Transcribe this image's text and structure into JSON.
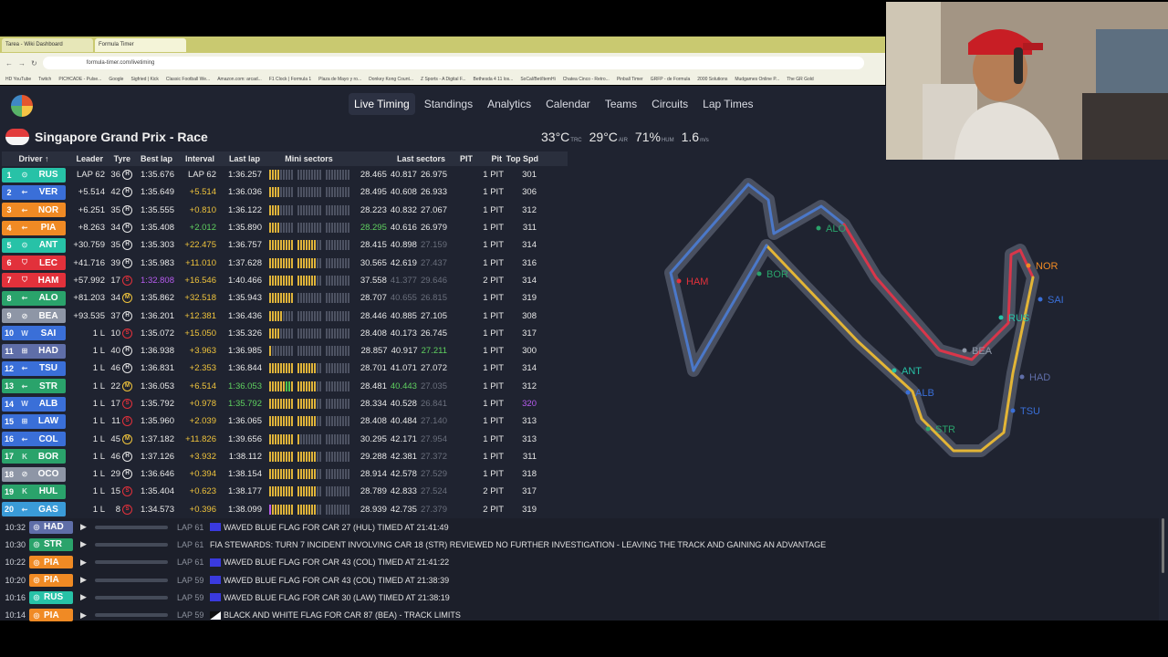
{
  "browser": {
    "tabs": [
      "Tarea - Wiki Dashboard",
      "Formula Timer"
    ],
    "url": "formula-timer.com/livetiming",
    "bookmarks": [
      "HD YouTube",
      "Twitch",
      "PICHCADE - Pulse...",
      "Google",
      "Sigfried | Kick",
      "Classic Football We...",
      "Amazon.com: arcad...",
      "F1 Clock | Formula 1",
      "Plaza de Mayo y ro...",
      "Donkey Kong Count...",
      "Z Sports - A Digital F...",
      "Bethesda 4 11 los...",
      "SoCal/Bet/ItemHi",
      "Chatea Cinco - Retro...",
      "Pinball Timer",
      "GRFP - de Formula",
      "2000 Solutions",
      "Mudgames Online P...",
      "The GR Gold"
    ]
  },
  "nav": {
    "items": [
      "Live Timing",
      "Standings",
      "Analytics",
      "Calendar",
      "Teams",
      "Circuits",
      "Lap Times"
    ],
    "active": "Live Timing"
  },
  "race": {
    "title": "Singapore Grand Prix - Race",
    "weather": {
      "track_temp": "33°C",
      "track_label": "TRC",
      "air_temp": "29°C",
      "air_label": "AIR",
      "humidity": "71%",
      "humidity_label": "HUM",
      "wind": "1.6",
      "wind_label": "m/s"
    }
  },
  "table": {
    "headers": [
      "Driver ↑",
      "Leader",
      "Tyre",
      "Best lap",
      "Interval",
      "Last lap",
      "Mini sectors",
      "Last sectors",
      "PIT",
      "Pit",
      "Top Spd"
    ],
    "rows": [
      {
        "pos": "1",
        "code": "RUS",
        "color": "#27c2a7",
        "icon": "⊙",
        "leader": "LAP 62",
        "laps": "36",
        "tyre": "H",
        "best": "1:35.676",
        "bestc": "white",
        "int": "LAP 62",
        "intc": "white",
        "last": "1:36.257",
        "lastc": "white",
        "mini": "yyyydddddddddddd",
        "s1": "28.465",
        "s1c": "white",
        "s2": "40.817",
        "s2c": "white",
        "s3": "26.975",
        "s3c": "white",
        "pit": "",
        "pits": "1 PIT",
        "spd": "301",
        "spdc": "white"
      },
      {
        "pos": "2",
        "code": "VER",
        "color": "#3a6fd8",
        "icon": "⇜",
        "leader": "+5.514",
        "laps": "42",
        "tyre": "H",
        "best": "1:35.649",
        "bestc": "white",
        "int": "+5.514",
        "intc": "yellow",
        "last": "1:36.036",
        "lastc": "white",
        "mini": "yyyydddddddddddd",
        "s1": "28.495",
        "s1c": "white",
        "s2": "40.608",
        "s2c": "white",
        "s3": "26.933",
        "s3c": "white",
        "pit": "",
        "pits": "1 PIT",
        "spd": "306",
        "spdc": "white"
      },
      {
        "pos": "3",
        "code": "NOR",
        "color": "#f08a24",
        "icon": "⇜",
        "leader": "+6.251",
        "laps": "35",
        "tyre": "H",
        "best": "1:35.555",
        "bestc": "white",
        "int": "+0.810",
        "intc": "yellow",
        "last": "1:36.122",
        "lastc": "white",
        "mini": "yyyydddddddddddd",
        "s1": "28.223",
        "s1c": "white",
        "s2": "40.832",
        "s2c": "white",
        "s3": "27.067",
        "s3c": "white",
        "pit": "",
        "pits": "1 PIT",
        "spd": "312",
        "spdc": "white"
      },
      {
        "pos": "4",
        "code": "PIA",
        "color": "#f08a24",
        "icon": "⇜",
        "leader": "+8.263",
        "laps": "34",
        "tyre": "H",
        "best": "1:35.408",
        "bestc": "white",
        "int": "+2.012",
        "intc": "green",
        "last": "1:35.890",
        "lastc": "white",
        "mini": "yyyydddddddddddd",
        "s1": "28.295",
        "s1c": "green",
        "s2": "40.616",
        "s2c": "white",
        "s3": "26.979",
        "s3c": "white",
        "pit": "",
        "pits": "1 PIT",
        "spd": "311",
        "spdc": "white"
      },
      {
        "pos": "5",
        "code": "ANT",
        "color": "#27c2a7",
        "icon": "⊙",
        "leader": "+30.759",
        "laps": "35",
        "tyre": "H",
        "best": "1:35.303",
        "bestc": "white",
        "int": "+22.475",
        "intc": "yellow",
        "last": "1:36.757",
        "lastc": "white",
        "mini": "yyyyyyyyyyyyyyyy",
        "s1": "28.415",
        "s1c": "white",
        "s2": "40.898",
        "s2c": "white",
        "s3": "27.159",
        "s3c": "dim",
        "pit": "",
        "pits": "1 PIT",
        "spd": "314",
        "spdc": "white"
      },
      {
        "pos": "6",
        "code": "LEC",
        "color": "#e2313b",
        "icon": "⛉",
        "leader": "+41.716",
        "laps": "39",
        "tyre": "H",
        "best": "1:35.983",
        "bestc": "white",
        "int": "+11.010",
        "intc": "yellow",
        "last": "1:37.628",
        "lastc": "white",
        "mini": "yyyyyyyyyyyyyyyy",
        "s1": "30.565",
        "s1c": "white",
        "s2": "42.619",
        "s2c": "white",
        "s3": "27.437",
        "s3c": "dim",
        "pit": "",
        "pits": "1 PIT",
        "spd": "316",
        "spdc": "white"
      },
      {
        "pos": "7",
        "code": "HAM",
        "color": "#e2313b",
        "icon": "⛉",
        "leader": "+57.992",
        "laps": "17",
        "tyre": "S",
        "best": "1:32.808",
        "bestc": "purple",
        "int": "+16.546",
        "intc": "yellow",
        "last": "1:40.466",
        "lastc": "white",
        "mini": "yyyyyyyyyyyyyyyy",
        "s1": "37.558",
        "s1c": "white",
        "s2": "41.377",
        "s2c": "dim",
        "s3": "29.646",
        "s3c": "dim",
        "pit": "",
        "pits": "2 PIT",
        "spd": "314",
        "spdc": "white"
      },
      {
        "pos": "8",
        "code": "ALO",
        "color": "#2aa36b",
        "icon": "⇜",
        "leader": "+81.203",
        "laps": "34",
        "tyre": "M",
        "best": "1:35.862",
        "bestc": "white",
        "int": "+32.518",
        "intc": "yellow",
        "last": "1:35.943",
        "lastc": "white",
        "mini": "yyyyyyyyydddddd",
        "s1": "28.707",
        "s1c": "white",
        "s2": "40.655",
        "s2c": "dim",
        "s3": "26.815",
        "s3c": "dim",
        "pit": "",
        "pits": "1 PIT",
        "spd": "319",
        "spdc": "white"
      },
      {
        "pos": "9",
        "code": "BEA",
        "color": "#8e96a6",
        "icon": "⊘",
        "leader": "+93.535",
        "laps": "37",
        "tyre": "H",
        "best": "1:36.201",
        "bestc": "white",
        "int": "+12.381",
        "intc": "yellow",
        "last": "1:36.436",
        "lastc": "white",
        "mini": "yyyyyddddddddddd",
        "s1": "28.446",
        "s1c": "white",
        "s2": "40.885",
        "s2c": "white",
        "s3": "27.105",
        "s3c": "white",
        "pit": "",
        "pits": "1 PIT",
        "spd": "308",
        "spdc": "white"
      },
      {
        "pos": "10",
        "code": "SAI",
        "color": "#3a6fd8",
        "icon": "W",
        "leader": "1 L",
        "laps": "10",
        "tyre": "S",
        "best": "1:35.072",
        "bestc": "white",
        "int": "+15.050",
        "intc": "yellow",
        "last": "1:35.326",
        "lastc": "white",
        "mini": "yyyydddddddddddd",
        "s1": "28.408",
        "s1c": "white",
        "s2": "40.173",
        "s2c": "white",
        "s3": "26.745",
        "s3c": "white",
        "pit": "",
        "pits": "1 PIT",
        "spd": "317",
        "spdc": "white"
      },
      {
        "pos": "11",
        "code": "HAD",
        "color": "#5f6ea8",
        "icon": "⊞",
        "leader": "1 L",
        "laps": "40",
        "tyre": "H",
        "best": "1:36.938",
        "bestc": "white",
        "int": "+3.963",
        "intc": "yellow",
        "last": "1:36.985",
        "lastc": "white",
        "mini": "ydddddddddddddd",
        "s1": "28.857",
        "s1c": "white",
        "s2": "40.917",
        "s2c": "white",
        "s3": "27.211",
        "s3c": "green",
        "pit": "",
        "pits": "1 PIT",
        "spd": "300",
        "spdc": "white"
      },
      {
        "pos": "12",
        "code": "TSU",
        "color": "#3a6fd8",
        "icon": "⇜",
        "leader": "1 L",
        "laps": "46",
        "tyre": "H",
        "best": "1:36.831",
        "bestc": "white",
        "int": "+2.353",
        "intc": "yellow",
        "last": "1:36.844",
        "lastc": "white",
        "mini": "yyyyyyyyyyyyyyyy",
        "s1": "28.701",
        "s1c": "white",
        "s2": "41.071",
        "s2c": "white",
        "s3": "27.072",
        "s3c": "white",
        "pit": "",
        "pits": "1 PIT",
        "spd": "314",
        "spdc": "white"
      },
      {
        "pos": "13",
        "code": "STR",
        "color": "#2aa36b",
        "icon": "⇜",
        "leader": "1 L",
        "laps": "22",
        "tyre": "M",
        "best": "1:36.053",
        "bestc": "white",
        "int": "+6.514",
        "intc": "yellow",
        "last": "1:36.053",
        "lastc": "green",
        "mini": "yyyyyyggyyyyyyyy",
        "s1": "28.481",
        "s1c": "white",
        "s2": "40.443",
        "s2c": "green",
        "s3": "27.035",
        "s3c": "dim",
        "pit": "",
        "pits": "1 PIT",
        "spd": "312",
        "spdc": "white"
      },
      {
        "pos": "14",
        "code": "ALB",
        "color": "#3a6fd8",
        "icon": "W",
        "leader": "1 L",
        "laps": "17",
        "tyre": "S",
        "best": "1:35.792",
        "bestc": "white",
        "int": "+0.978",
        "intc": "yellow",
        "last": "1:35.792",
        "lastc": "green",
        "mini": "yyyyyyyyyyyyyyyy",
        "s1": "28.334",
        "s1c": "white",
        "s2": "40.528",
        "s2c": "white",
        "s3": "26.841",
        "s3c": "dim",
        "pit": "",
        "pits": "1 PIT",
        "spd": "320",
        "spdc": "purple"
      },
      {
        "pos": "15",
        "code": "LAW",
        "color": "#3a6fd8",
        "icon": "⊞",
        "leader": "1 L",
        "laps": "11",
        "tyre": "S",
        "best": "1:35.960",
        "bestc": "white",
        "int": "+2.039",
        "intc": "yellow",
        "last": "1:36.065",
        "lastc": "white",
        "mini": "yyyyyyyyyyyyyyyy",
        "s1": "28.408",
        "s1c": "white",
        "s2": "40.484",
        "s2c": "white",
        "s3": "27.140",
        "s3c": "dim",
        "pit": "",
        "pits": "1 PIT",
        "spd": "313",
        "spdc": "white"
      },
      {
        "pos": "16",
        "code": "COL",
        "color": "#3a6fd8",
        "icon": "⇜",
        "leader": "1 L",
        "laps": "45",
        "tyre": "M",
        "best": "1:37.182",
        "bestc": "white",
        "int": "+11.826",
        "intc": "yellow",
        "last": "1:39.656",
        "lastc": "white",
        "mini": "yyyyyyyyyydddddd",
        "s1": "30.295",
        "s1c": "white",
        "s2": "42.171",
        "s2c": "white",
        "s3": "27.954",
        "s3c": "dim",
        "pit": "",
        "pits": "1 PIT",
        "spd": "313",
        "spdc": "white"
      },
      {
        "pos": "17",
        "code": "BOR",
        "color": "#2aa36b",
        "icon": "K",
        "leader": "1 L",
        "laps": "46",
        "tyre": "H",
        "best": "1:37.126",
        "bestc": "white",
        "int": "+3.932",
        "intc": "yellow",
        "last": "1:38.112",
        "lastc": "white",
        "mini": "yyyyyyyyyyyyyyyy",
        "s1": "29.288",
        "s1c": "white",
        "s2": "42.381",
        "s2c": "white",
        "s3": "27.372",
        "s3c": "dim",
        "pit": "",
        "pits": "1 PIT",
        "spd": "311",
        "spdc": "white"
      },
      {
        "pos": "18",
        "code": "OCO",
        "color": "#8e96a6",
        "icon": "⊘",
        "leader": "1 L",
        "laps": "29",
        "tyre": "H",
        "best": "1:36.646",
        "bestc": "white",
        "int": "+0.394",
        "intc": "yellow",
        "last": "1:38.154",
        "lastc": "white",
        "mini": "yyyyyyyyyyyyyyyy",
        "s1": "28.914",
        "s1c": "white",
        "s2": "42.578",
        "s2c": "white",
        "s3": "27.529",
        "s3c": "dim",
        "pit": "",
        "pits": "1 PIT",
        "spd": "318",
        "spdc": "white"
      },
      {
        "pos": "19",
        "code": "HUL",
        "color": "#2aa36b",
        "icon": "K",
        "leader": "1 L",
        "laps": "15",
        "tyre": "S",
        "best": "1:35.404",
        "bestc": "white",
        "int": "+0.623",
        "intc": "yellow",
        "last": "1:38.177",
        "lastc": "white",
        "mini": "yyyyyyyyyyyyyyyy",
        "s1": "28.789",
        "s1c": "white",
        "s2": "42.833",
        "s2c": "white",
        "s3": "27.524",
        "s3c": "dim",
        "pit": "",
        "pits": "2 PIT",
        "spd": "317",
        "spdc": "white"
      },
      {
        "pos": "20",
        "code": "GAS",
        "color": "#3a9bd8",
        "icon": "⇜",
        "leader": "1 L",
        "laps": "8",
        "tyre": "S",
        "best": "1:34.573",
        "bestc": "white",
        "int": "+0.396",
        "intc": "yellow",
        "last": "1:38.099",
        "lastc": "white",
        "mini": "pyyyyyyyyyyyyyyy",
        "s1": "28.939",
        "s1c": "white",
        "s2": "42.735",
        "s2c": "white",
        "s3": "27.379",
        "s3c": "dim",
        "pit": "",
        "pits": "2 PIT",
        "spd": "319",
        "spdc": "white"
      }
    ]
  },
  "race_control": [
    {
      "time": "10:32",
      "code": "HAD",
      "color": "#5f6ea8",
      "lap": "LAP 61",
      "flag": "#3a3adf",
      "msg": "WAVED BLUE FLAG FOR CAR 27 (HUL) TIMED AT 21:41:49"
    },
    {
      "time": "10:30",
      "code": "STR",
      "color": "#2aa36b",
      "lap": "LAP 61",
      "flag": "",
      "msg": "FIA STEWARDS: TURN 7 INCIDENT INVOLVING CAR 18 (STR) REVIEWED NO FURTHER INVESTIGATION - LEAVING THE TRACK AND GAINING AN ADVANTAGE"
    },
    {
      "time": "10:22",
      "code": "PIA",
      "color": "#f08a24",
      "lap": "LAP 61",
      "flag": "#3a3adf",
      "msg": "WAVED BLUE FLAG FOR CAR 43 (COL) TIMED AT 21:41:22"
    },
    {
      "time": "10:20",
      "code": "PIA",
      "color": "#f08a24",
      "lap": "LAP 59",
      "flag": "#3a3adf",
      "msg": "WAVED BLUE FLAG FOR CAR 43 (COL) TIMED AT 21:38:39"
    },
    {
      "time": "10:16",
      "code": "RUS",
      "color": "#27c2a7",
      "lap": "LAP 59",
      "flag": "#3a3adf",
      "msg": "WAVED BLUE FLAG FOR CAR 30 (LAW) TIMED AT 21:38:19"
    },
    {
      "time": "10:14",
      "code": "PIA",
      "color": "#f08a24",
      "lap": "LAP 59",
      "flag": "bw",
      "msg": "BLACK AND WHITE FLAG FOR CAR 87 (BEA) - TRACK LIMITS"
    }
  ],
  "track_labels": [
    {
      "code": "ALO",
      "color": "#2aa36b"
    },
    {
      "code": "HAM",
      "color": "#e2313b"
    },
    {
      "code": "BOR",
      "color": "#2aa36b"
    },
    {
      "code": "NOR",
      "color": "#f08a24"
    },
    {
      "code": "SAI",
      "color": "#3a6fd8"
    },
    {
      "code": "RUS",
      "color": "#27c2a7"
    },
    {
      "code": "BEA",
      "color": "#8e96a6"
    },
    {
      "code": "HAD",
      "color": "#5f6ea8"
    },
    {
      "code": "ANT",
      "color": "#27c2a7"
    },
    {
      "code": "ALB",
      "color": "#3a6fd8"
    },
    {
      "code": "TSU",
      "color": "#3a6fd8"
    },
    {
      "code": "STR",
      "color": "#2aa36b"
    }
  ]
}
